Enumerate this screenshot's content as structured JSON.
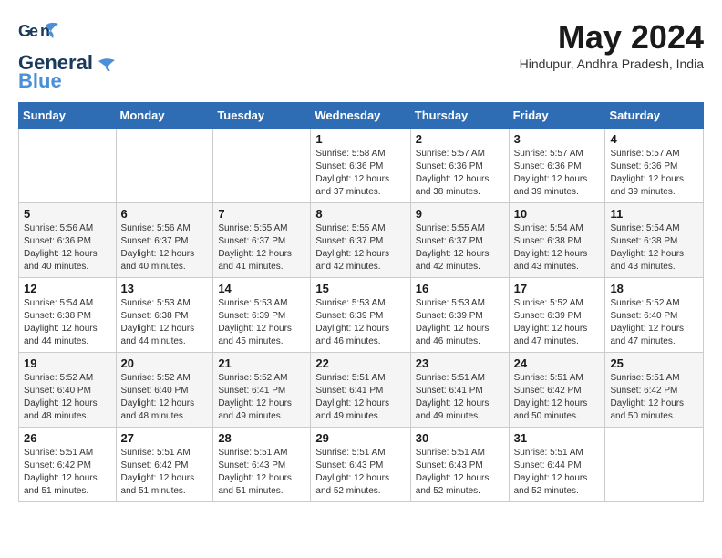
{
  "header": {
    "logo_line1": "General",
    "logo_line2": "Blue",
    "month": "May 2024",
    "location": "Hindupur, Andhra Pradesh, India"
  },
  "weekdays": [
    "Sunday",
    "Monday",
    "Tuesday",
    "Wednesday",
    "Thursday",
    "Friday",
    "Saturday"
  ],
  "weeks": [
    [
      {
        "day": "",
        "sunrise": "",
        "sunset": "",
        "daylight": ""
      },
      {
        "day": "",
        "sunrise": "",
        "sunset": "",
        "daylight": ""
      },
      {
        "day": "",
        "sunrise": "",
        "sunset": "",
        "daylight": ""
      },
      {
        "day": "1",
        "sunrise": "Sunrise: 5:58 AM",
        "sunset": "Sunset: 6:36 PM",
        "daylight": "Daylight: 12 hours and 37 minutes."
      },
      {
        "day": "2",
        "sunrise": "Sunrise: 5:57 AM",
        "sunset": "Sunset: 6:36 PM",
        "daylight": "Daylight: 12 hours and 38 minutes."
      },
      {
        "day": "3",
        "sunrise": "Sunrise: 5:57 AM",
        "sunset": "Sunset: 6:36 PM",
        "daylight": "Daylight: 12 hours and 39 minutes."
      },
      {
        "day": "4",
        "sunrise": "Sunrise: 5:57 AM",
        "sunset": "Sunset: 6:36 PM",
        "daylight": "Daylight: 12 hours and 39 minutes."
      }
    ],
    [
      {
        "day": "5",
        "sunrise": "Sunrise: 5:56 AM",
        "sunset": "Sunset: 6:36 PM",
        "daylight": "Daylight: 12 hours and 40 minutes."
      },
      {
        "day": "6",
        "sunrise": "Sunrise: 5:56 AM",
        "sunset": "Sunset: 6:37 PM",
        "daylight": "Daylight: 12 hours and 40 minutes."
      },
      {
        "day": "7",
        "sunrise": "Sunrise: 5:55 AM",
        "sunset": "Sunset: 6:37 PM",
        "daylight": "Daylight: 12 hours and 41 minutes."
      },
      {
        "day": "8",
        "sunrise": "Sunrise: 5:55 AM",
        "sunset": "Sunset: 6:37 PM",
        "daylight": "Daylight: 12 hours and 42 minutes."
      },
      {
        "day": "9",
        "sunrise": "Sunrise: 5:55 AM",
        "sunset": "Sunset: 6:37 PM",
        "daylight": "Daylight: 12 hours and 42 minutes."
      },
      {
        "day": "10",
        "sunrise": "Sunrise: 5:54 AM",
        "sunset": "Sunset: 6:38 PM",
        "daylight": "Daylight: 12 hours and 43 minutes."
      },
      {
        "day": "11",
        "sunrise": "Sunrise: 5:54 AM",
        "sunset": "Sunset: 6:38 PM",
        "daylight": "Daylight: 12 hours and 43 minutes."
      }
    ],
    [
      {
        "day": "12",
        "sunrise": "Sunrise: 5:54 AM",
        "sunset": "Sunset: 6:38 PM",
        "daylight": "Daylight: 12 hours and 44 minutes."
      },
      {
        "day": "13",
        "sunrise": "Sunrise: 5:53 AM",
        "sunset": "Sunset: 6:38 PM",
        "daylight": "Daylight: 12 hours and 44 minutes."
      },
      {
        "day": "14",
        "sunrise": "Sunrise: 5:53 AM",
        "sunset": "Sunset: 6:39 PM",
        "daylight": "Daylight: 12 hours and 45 minutes."
      },
      {
        "day": "15",
        "sunrise": "Sunrise: 5:53 AM",
        "sunset": "Sunset: 6:39 PM",
        "daylight": "Daylight: 12 hours and 46 minutes."
      },
      {
        "day": "16",
        "sunrise": "Sunrise: 5:53 AM",
        "sunset": "Sunset: 6:39 PM",
        "daylight": "Daylight: 12 hours and 46 minutes."
      },
      {
        "day": "17",
        "sunrise": "Sunrise: 5:52 AM",
        "sunset": "Sunset: 6:39 PM",
        "daylight": "Daylight: 12 hours and 47 minutes."
      },
      {
        "day": "18",
        "sunrise": "Sunrise: 5:52 AM",
        "sunset": "Sunset: 6:40 PM",
        "daylight": "Daylight: 12 hours and 47 minutes."
      }
    ],
    [
      {
        "day": "19",
        "sunrise": "Sunrise: 5:52 AM",
        "sunset": "Sunset: 6:40 PM",
        "daylight": "Daylight: 12 hours and 48 minutes."
      },
      {
        "day": "20",
        "sunrise": "Sunrise: 5:52 AM",
        "sunset": "Sunset: 6:40 PM",
        "daylight": "Daylight: 12 hours and 48 minutes."
      },
      {
        "day": "21",
        "sunrise": "Sunrise: 5:52 AM",
        "sunset": "Sunset: 6:41 PM",
        "daylight": "Daylight: 12 hours and 49 minutes."
      },
      {
        "day": "22",
        "sunrise": "Sunrise: 5:51 AM",
        "sunset": "Sunset: 6:41 PM",
        "daylight": "Daylight: 12 hours and 49 minutes."
      },
      {
        "day": "23",
        "sunrise": "Sunrise: 5:51 AM",
        "sunset": "Sunset: 6:41 PM",
        "daylight": "Daylight: 12 hours and 49 minutes."
      },
      {
        "day": "24",
        "sunrise": "Sunrise: 5:51 AM",
        "sunset": "Sunset: 6:42 PM",
        "daylight": "Daylight: 12 hours and 50 minutes."
      },
      {
        "day": "25",
        "sunrise": "Sunrise: 5:51 AM",
        "sunset": "Sunset: 6:42 PM",
        "daylight": "Daylight: 12 hours and 50 minutes."
      }
    ],
    [
      {
        "day": "26",
        "sunrise": "Sunrise: 5:51 AM",
        "sunset": "Sunset: 6:42 PM",
        "daylight": "Daylight: 12 hours and 51 minutes."
      },
      {
        "day": "27",
        "sunrise": "Sunrise: 5:51 AM",
        "sunset": "Sunset: 6:42 PM",
        "daylight": "Daylight: 12 hours and 51 minutes."
      },
      {
        "day": "28",
        "sunrise": "Sunrise: 5:51 AM",
        "sunset": "Sunset: 6:43 PM",
        "daylight": "Daylight: 12 hours and 51 minutes."
      },
      {
        "day": "29",
        "sunrise": "Sunrise: 5:51 AM",
        "sunset": "Sunset: 6:43 PM",
        "daylight": "Daylight: 12 hours and 52 minutes."
      },
      {
        "day": "30",
        "sunrise": "Sunrise: 5:51 AM",
        "sunset": "Sunset: 6:43 PM",
        "daylight": "Daylight: 12 hours and 52 minutes."
      },
      {
        "day": "31",
        "sunrise": "Sunrise: 5:51 AM",
        "sunset": "Sunset: 6:44 PM",
        "daylight": "Daylight: 12 hours and 52 minutes."
      },
      {
        "day": "",
        "sunrise": "",
        "sunset": "",
        "daylight": ""
      }
    ]
  ]
}
